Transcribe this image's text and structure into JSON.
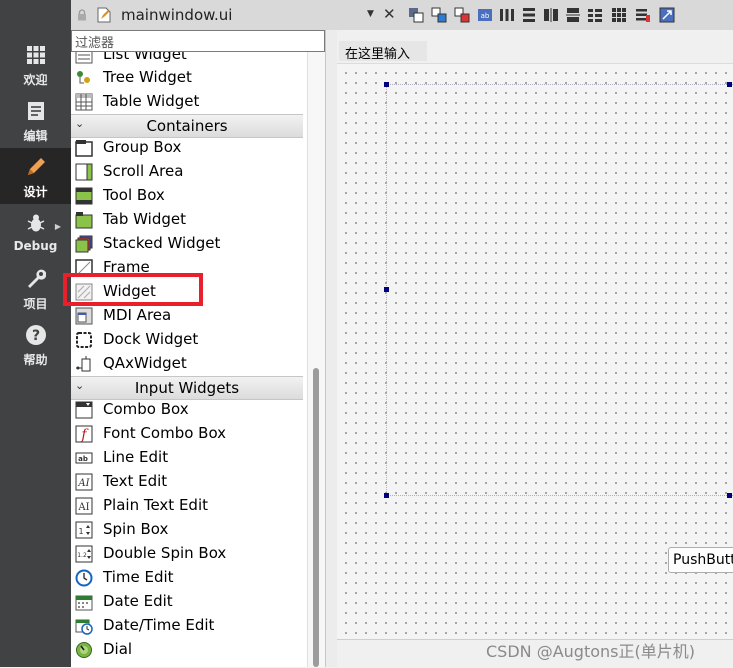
{
  "modebar": {
    "items": [
      {
        "label": "欢迎",
        "icon": "grid-icon"
      },
      {
        "label": "编辑",
        "icon": "document-icon"
      },
      {
        "label": "设计",
        "icon": "pencil-icon",
        "active": true
      },
      {
        "label": "Debug",
        "icon": "bug-icon"
      },
      {
        "label": "项目",
        "icon": "wrench-icon"
      },
      {
        "label": "帮助",
        "icon": "help-icon"
      }
    ]
  },
  "topbar": {
    "file_title": "mainwindow.ui",
    "dropdown_glyph": "▼",
    "close_glyph": "✕"
  },
  "widgetbox": {
    "filter_placeholder": "过滤器",
    "items": [
      {
        "type": "item",
        "label": "List Widget",
        "icon": "list-widget-icon"
      },
      {
        "type": "item",
        "label": "Tree Widget",
        "icon": "tree-widget-icon"
      },
      {
        "type": "item",
        "label": "Table Widget",
        "icon": "table-widget-icon"
      },
      {
        "type": "category",
        "label": "Containers"
      },
      {
        "type": "item",
        "label": "Group Box",
        "icon": "group-box-icon"
      },
      {
        "type": "item",
        "label": "Scroll Area",
        "icon": "scroll-area-icon"
      },
      {
        "type": "item",
        "label": "Tool Box",
        "icon": "tool-box-icon"
      },
      {
        "type": "item",
        "label": "Tab Widget",
        "icon": "tab-widget-icon"
      },
      {
        "type": "item",
        "label": "Stacked Widget",
        "icon": "stacked-widget-icon"
      },
      {
        "type": "item",
        "label": "Frame",
        "icon": "frame-icon"
      },
      {
        "type": "item",
        "label": "Widget",
        "icon": "widget-icon"
      },
      {
        "type": "item",
        "label": "MDI Area",
        "icon": "mdi-area-icon"
      },
      {
        "type": "item",
        "label": "Dock Widget",
        "icon": "dock-widget-icon"
      },
      {
        "type": "item",
        "label": "QAxWidget",
        "icon": "qaxwidget-icon"
      },
      {
        "type": "category",
        "label": "Input Widgets"
      },
      {
        "type": "item",
        "label": "Combo Box",
        "icon": "combo-box-icon"
      },
      {
        "type": "item",
        "label": "Font Combo Box",
        "icon": "font-combo-box-icon"
      },
      {
        "type": "item",
        "label": "Line Edit",
        "icon": "line-edit-icon"
      },
      {
        "type": "item",
        "label": "Text Edit",
        "icon": "text-edit-icon"
      },
      {
        "type": "item",
        "label": "Plain Text Edit",
        "icon": "plain-text-edit-icon"
      },
      {
        "type": "item",
        "label": "Spin Box",
        "icon": "spin-box-icon"
      },
      {
        "type": "item",
        "label": "Double Spin Box",
        "icon": "double-spin-box-icon"
      },
      {
        "type": "item",
        "label": "Time Edit",
        "icon": "time-edit-icon"
      },
      {
        "type": "item",
        "label": "Date Edit",
        "icon": "date-edit-icon"
      },
      {
        "type": "item",
        "label": "Date/Time Edit",
        "icon": "date-time-edit-icon"
      },
      {
        "type": "item",
        "label": "Dial",
        "icon": "dial-icon"
      }
    ]
  },
  "form": {
    "menu_placeholder": "在这里输入",
    "push_button_label": "PushButton"
  },
  "watermark": "CSDN @Augtons正(单片机)",
  "colors": {
    "modebar_bg": "#404244",
    "modebar_active": "#262626",
    "highlight_box": "#e8202c",
    "selection_handle": "#00007f"
  }
}
